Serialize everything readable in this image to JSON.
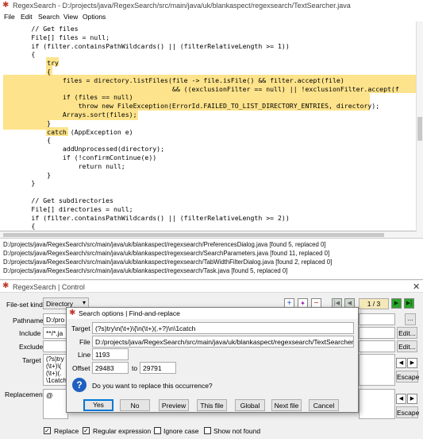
{
  "app": {
    "title": "RegexSearch - D:/projects/java/RegexSearch/src/main/java/uk/blankaspect/regexsearch/TextSearcher.java"
  },
  "menu": [
    "File",
    "Edit",
    "Search",
    "View",
    "Options"
  ],
  "code": [
    "        // Get files",
    "        File[] files = null;",
    "        if (filter.containsPathWildcards() || (filterRelativeLength >= 1))",
    "        {",
    "            try",
    "            {",
    "                files = directory.listFiles(file -> file.isFile() && filter.accept(file)",
    "                                            && ((exclusionFilter == null) || !exclusionFilter.accept(f",
    "                if (files == null)",
    "                    throw new FileException(ErrorId.FAILED_TO_LIST_DIRECTORY_ENTRIES, directory);",
    "                Arrays.sort(files);",
    "            }",
    "            catch (AppException e)",
    "            {",
    "                addUnprocessed(directory);",
    "                if (!confirmContinue(e))",
    "                    return null;",
    "            }",
    "        }",
    "",
    "        // Get subdirectories",
    "        File[] directories = null;",
    "        if (filter.containsPathWildcards() || (filterRelativeLength >= 2))",
    "        {"
  ],
  "log": [
    "D:/projects/java/RegexSearch/src/main/java/uk/blankaspect/regexsearch/PreferencesDialog.java  [found 5, replaced 0]",
    "D:/projects/java/RegexSearch/src/main/java/uk/blankaspect/regexsearch/SearchParameters.java  [found 11, replaced 0]",
    "D:/projects/java/RegexSearch/src/main/java/uk/blankaspect/regexsearch/TabWidthFilterDialog.java  [found 2, replaced 0]",
    "D:/projects/java/RegexSearch/src/main/java/uk/blankaspect/regexsearch/Task.java  [found 5, replaced 0]"
  ],
  "control": {
    "title": "RegexSearch | Control",
    "fileset_label": "File-set kind",
    "fileset_value": "Directory",
    "pathname_label": "Pathname",
    "pathname_value": "D:/pro",
    "include_label": "Include",
    "include_value": "**/*.ja",
    "exclude_label": "Exclude",
    "target_label": "Target",
    "target_lines": [
      "(?s)try",
      "(\\t+)\\(",
      "(\\t+)(.",
      "\\1catch"
    ],
    "replacement_label": "Replacement",
    "replacement_value": "@",
    "page": "1 / 3",
    "edit": "Edit...",
    "escape": "Escape",
    "options": [
      "Replace",
      "Regular expression",
      "Ignore case",
      "Show not found"
    ],
    "checked": [
      true,
      true,
      false,
      false
    ]
  },
  "dialog": {
    "title": "Search options | Find-and-replace",
    "target_label": "Target",
    "target_value": "(?s)try\\n(\\t+)\\{\\n(\\t+)(.+?)\\n\\1catch",
    "file_label": "File",
    "file_value": "D:/projects/java/RegexSearch/src/main/java/uk/blankaspect/regexsearch/TextSearcher.java",
    "line_label": "Line",
    "line_value": "1193",
    "offset_label": "Offset",
    "offset_from": "29483",
    "offset_to_label": "to",
    "offset_to": "29791",
    "question": "Do you want to replace this occurrence?",
    "buttons": [
      "Yes",
      "No",
      "Preview",
      "This file",
      "Global",
      "Next file",
      "Cancel"
    ]
  },
  "colors": {
    "highlight": "#fde38b",
    "selection": "#cce4f7",
    "nav_green": "#1a8a1a"
  }
}
